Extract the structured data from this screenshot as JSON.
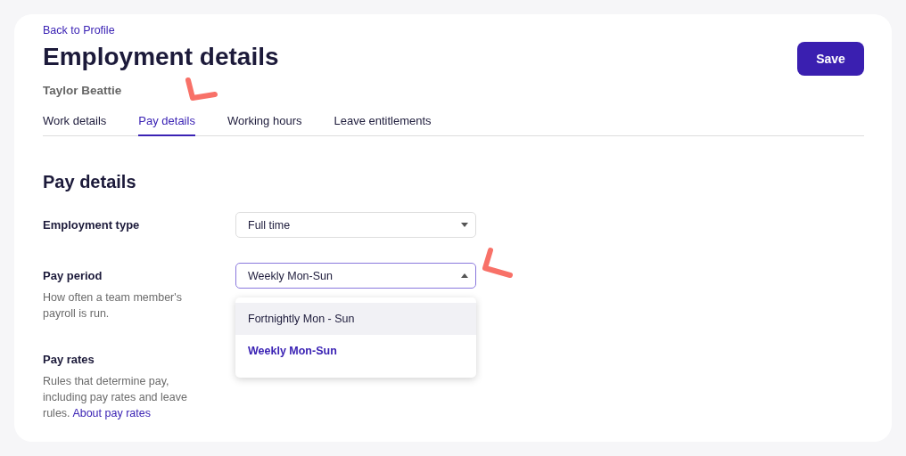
{
  "back_link": "Back to Profile",
  "title": "Employment details",
  "subtitle": "Taylor Beattie",
  "save_button": "Save",
  "tabs": [
    {
      "label": "Work details",
      "selected": false
    },
    {
      "label": "Pay details",
      "selected": true
    },
    {
      "label": "Working hours",
      "selected": false
    },
    {
      "label": "Leave entitlements",
      "selected": false
    }
  ],
  "section_title": "Pay details",
  "fields": [
    {
      "label": "Employment type",
      "value": "Full time",
      "open": false
    },
    {
      "label": "Pay period",
      "help": "How often a team member's payroll is run.",
      "value": "Weekly Mon-Sun",
      "open": true,
      "options": [
        {
          "label": "Fortnightly Mon - Sun",
          "selected": false,
          "hovered": true
        },
        {
          "label": "Weekly Mon-Sun",
          "selected": true,
          "hovered": false
        }
      ]
    },
    {
      "label": "Pay rates",
      "help": "Rules that determine pay, including pay rates and leave rules.",
      "link": "About pay rates"
    }
  ]
}
